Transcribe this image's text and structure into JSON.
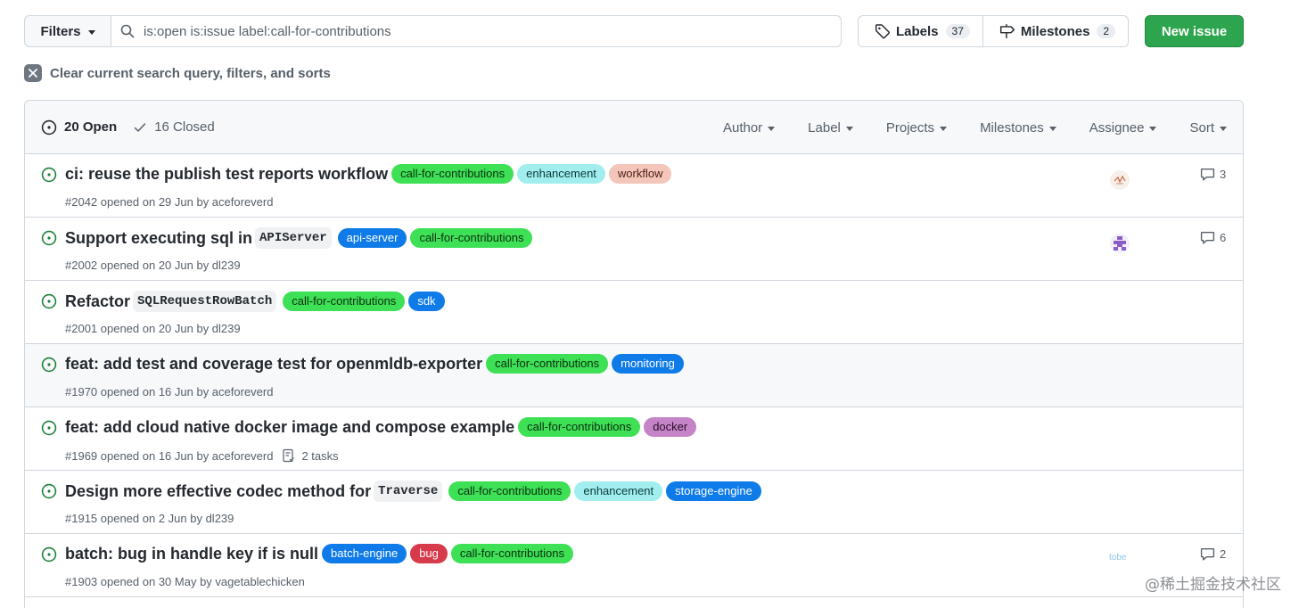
{
  "toolbar": {
    "filters_label": "Filters",
    "search_value": "is:open is:issue label:call-for-contributions",
    "labels_label": "Labels",
    "labels_count": "37",
    "milestones_label": "Milestones",
    "milestones_count": "2",
    "new_issue_label": "New issue"
  },
  "clear_query_text": "Clear current search query, filters, and sorts",
  "list_header": {
    "open_label": "20 Open",
    "closed_label": "16 Closed",
    "filters": [
      "Author",
      "Label",
      "Projects",
      "Milestones",
      "Assignee",
      "Sort"
    ]
  },
  "colors": {
    "call-for-contributions": "#3ee055",
    "enhancement": "#a2eeef",
    "workflow": "#f4c6b9",
    "api-server": "#0e7be8",
    "sdk": "#0e7be8",
    "monitoring": "#0e7be8",
    "docker": "#c583c8",
    "storage-engine": "#0e7be8",
    "batch-engine": "#0e7be8",
    "bug": "#d73a4a",
    "open_icon": "#1a7f37"
  },
  "issues": [
    {
      "title": "ci: reuse the publish test reports workflow",
      "code": "",
      "title_after": "",
      "labels": [
        {
          "name": "call-for-contributions",
          "bg": "#3ee055",
          "fg": "#0b2f11"
        },
        {
          "name": "enhancement",
          "bg": "#a2eeef",
          "fg": "#0b3a3b"
        },
        {
          "name": "workflow",
          "bg": "#f4c6b9",
          "fg": "#4a1e12"
        }
      ],
      "meta": "#2042 opened on 29 Jun by aceforeverd",
      "tasks": "",
      "avatar": "avatar-sketch",
      "comments": "3"
    },
    {
      "title": "Support executing sql in",
      "code": "APIServer",
      "title_after": "",
      "labels": [
        {
          "name": "api-server",
          "bg": "#0e7be8",
          "fg": "#ffffff"
        },
        {
          "name": "call-for-contributions",
          "bg": "#3ee055",
          "fg": "#0b2f11"
        }
      ],
      "meta": "#2002 opened on 20 Jun by dl239",
      "tasks": "",
      "avatar": "avatar-identicon",
      "comments": "6"
    },
    {
      "title": "Refactor",
      "code": "SQLRequestRowBatch",
      "title_after": "",
      "labels": [
        {
          "name": "call-for-contributions",
          "bg": "#3ee055",
          "fg": "#0b2f11"
        },
        {
          "name": "sdk",
          "bg": "#0e7be8",
          "fg": "#ffffff"
        }
      ],
      "meta": "#2001 opened on 20 Jun by dl239",
      "tasks": "",
      "avatar": "",
      "comments": ""
    },
    {
      "title": "feat: add test and coverage test for openmldb-exporter",
      "code": "",
      "title_after": "",
      "labels": [
        {
          "name": "call-for-contributions",
          "bg": "#3ee055",
          "fg": "#0b2f11"
        },
        {
          "name": "monitoring",
          "bg": "#0e7be8",
          "fg": "#ffffff"
        }
      ],
      "meta": "#1970 opened on 16 Jun by aceforeverd",
      "tasks": "",
      "avatar": "",
      "comments": "",
      "highlighted": true
    },
    {
      "title": "feat: add cloud native docker image and compose example",
      "code": "",
      "title_after": "",
      "labels": [
        {
          "name": "call-for-contributions",
          "bg": "#3ee055",
          "fg": "#0b2f11"
        },
        {
          "name": "docker",
          "bg": "#c583c8",
          "fg": "#2a0e2b"
        }
      ],
      "meta": "#1969 opened on 16 Jun by aceforeverd",
      "tasks": "2 tasks",
      "avatar": "",
      "comments": ""
    },
    {
      "title": "Design more effective codec method for",
      "code": "Traverse",
      "title_after": "",
      "labels": [
        {
          "name": "call-for-contributions",
          "bg": "#3ee055",
          "fg": "#0b2f11"
        },
        {
          "name": "enhancement",
          "bg": "#a2eeef",
          "fg": "#0b3a3b"
        },
        {
          "name": "storage-engine",
          "bg": "#0e7be8",
          "fg": "#ffffff"
        }
      ],
      "meta": "#1915 opened on 2 Jun by dl239",
      "tasks": "",
      "avatar": "",
      "comments": ""
    },
    {
      "title": "batch: bug in handle key if is null",
      "code": "",
      "title_after": "",
      "labels": [
        {
          "name": "batch-engine",
          "bg": "#0e7be8",
          "fg": "#ffffff"
        },
        {
          "name": "bug",
          "bg": "#d73a4a",
          "fg": "#ffffff"
        },
        {
          "name": "call-for-contributions",
          "bg": "#3ee055",
          "fg": "#0b2f11"
        }
      ],
      "meta": "#1903 opened on 30 May by vagetablechicken",
      "tasks": "",
      "avatar": "avatar-tobe",
      "avatar_text": "tobe",
      "comments": "2"
    }
  ],
  "watermark": "@稀土掘金技术社区"
}
